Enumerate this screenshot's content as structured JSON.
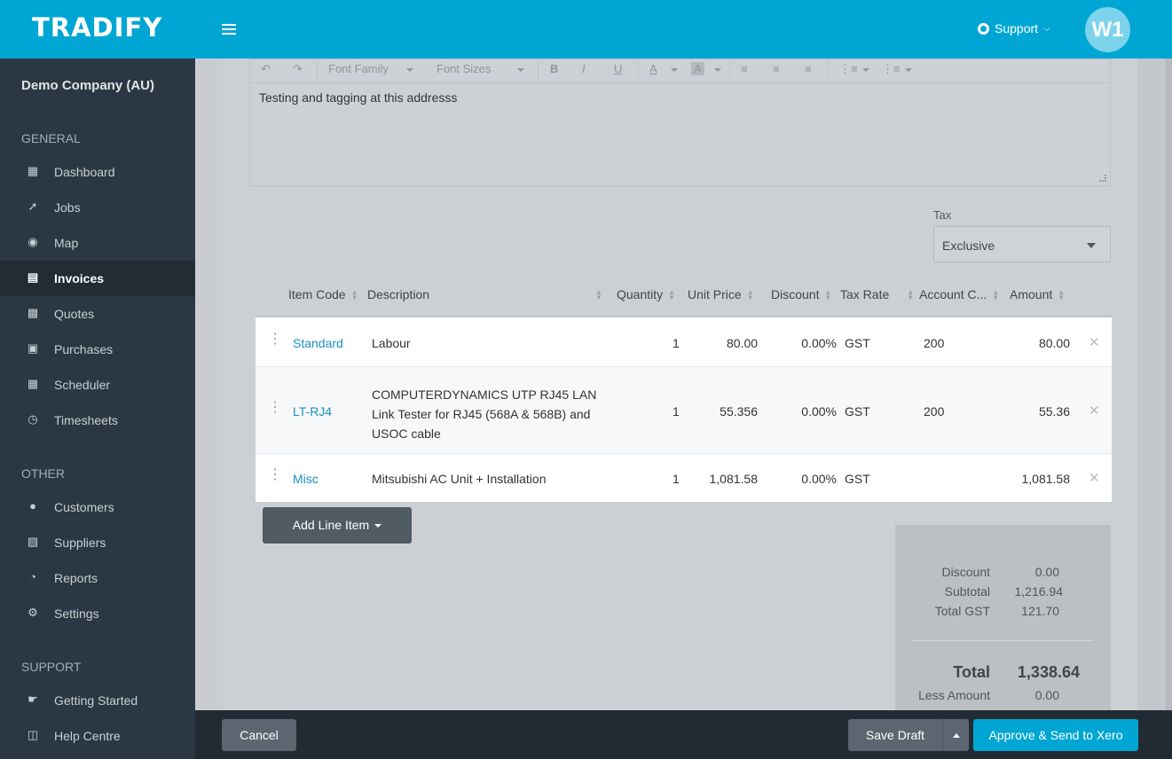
{
  "brand": {
    "logo": "TRADIFY",
    "color": "#00a6d3"
  },
  "header": {
    "support_label": "Support",
    "avatar_initials": "W1"
  },
  "sidebar": {
    "company": "Demo Company (AU)",
    "sections": [
      {
        "title": "GENERAL",
        "items": [
          {
            "label": "Dashboard",
            "icon": "dashboard-icon"
          },
          {
            "label": "Jobs",
            "icon": "hammer-icon"
          },
          {
            "label": "Map",
            "icon": "map-pin-icon"
          },
          {
            "label": "Invoices",
            "icon": "invoice-icon",
            "active": true
          },
          {
            "label": "Quotes",
            "icon": "calculator-icon"
          },
          {
            "label": "Purchases",
            "icon": "cart-icon"
          },
          {
            "label": "Scheduler",
            "icon": "calendar-icon"
          },
          {
            "label": "Timesheets",
            "icon": "clock-icon"
          }
        ]
      },
      {
        "title": "OTHER",
        "items": [
          {
            "label": "Customers",
            "icon": "users-icon"
          },
          {
            "label": "Suppliers",
            "icon": "truck-icon"
          },
          {
            "label": "Reports",
            "icon": "pie-chart-icon"
          },
          {
            "label": "Settings",
            "icon": "gear-icon"
          }
        ]
      },
      {
        "title": "SUPPORT",
        "items": [
          {
            "label": "Getting Started",
            "icon": "thumbs-up-icon"
          },
          {
            "label": "Help Centre",
            "icon": "book-icon"
          }
        ]
      }
    ]
  },
  "editor": {
    "font_family_label": "Font Family",
    "font_sizes_label": "Font Sizes",
    "text": "Testing and tagging at this addresss"
  },
  "tax": {
    "label": "Tax",
    "value": "Exclusive"
  },
  "table": {
    "headers": [
      "Item Code",
      "Description",
      "Quantity",
      "Unit Price",
      "Discount",
      "Tax Rate",
      "Account C...",
      "Amount"
    ],
    "rows": [
      {
        "code": "Standard",
        "description": [
          "Labour"
        ],
        "quantity": "1",
        "unit_price": "80.00",
        "discount": "0.00%",
        "tax_rate": "GST",
        "account": "200",
        "amount": "80.00"
      },
      {
        "code": "LT-RJ4",
        "description": [
          "COMPUTERDYNAMICS UTP RJ45 LAN",
          "Link Tester for RJ45 (568A & 568B) and",
          "USOC cable"
        ],
        "quantity": "1",
        "unit_price": "55.356",
        "discount": "0.00%",
        "tax_rate": "GST",
        "account": "200",
        "amount": "55.36"
      },
      {
        "code": "Misc",
        "description": [
          "Mitsubishi AC Unit + Installation"
        ],
        "quantity": "1",
        "unit_price": "1,081.58",
        "discount": "0.00%",
        "tax_rate": "GST",
        "account": "",
        "amount": "1,081.58"
      }
    ]
  },
  "add_line_item_label": "Add Line Item",
  "totals": {
    "discount_label": "Discount",
    "discount": "0.00",
    "subtotal_label": "Subtotal",
    "subtotal": "1,216.94",
    "gst_label": "Total GST",
    "gst": "121.70",
    "total_label": "Total",
    "total": "1,338.64",
    "less_label": "Less Amount",
    "less": "0.00"
  },
  "footer": {
    "cancel_label": "Cancel",
    "save_draft_label": "Save Draft",
    "approve_label": "Approve & Send to Xero"
  }
}
